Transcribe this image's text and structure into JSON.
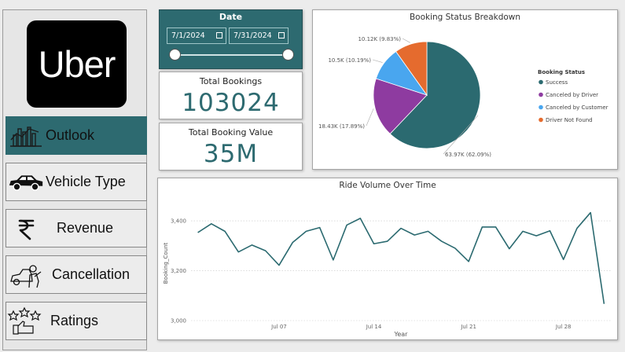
{
  "logo": {
    "text": "Uber"
  },
  "nav": [
    {
      "label": "Outlook",
      "icon": "bar-chart-icon",
      "active": true
    },
    {
      "label": "Vehicle Type",
      "icon": "car-icon",
      "active": false
    },
    {
      "label": "Revenue",
      "icon": "rupee-icon",
      "active": false
    },
    {
      "label": "Cancellation",
      "icon": "mechanic-icon",
      "active": false
    },
    {
      "label": "Ratings",
      "icon": "stars-thumbs-up-icon",
      "active": false
    }
  ],
  "date_filter": {
    "title": "Date",
    "start": "7/1/2024",
    "end": "7/31/2024"
  },
  "kpis": {
    "total_bookings": {
      "title": "Total Bookings",
      "value": "103024"
    },
    "total_booking_value": {
      "title": "Total Booking Value",
      "value": "35M"
    }
  },
  "colors": {
    "accent": "#2d6a70",
    "success": "#2b6a70",
    "driver": "#8e3ba0",
    "customer": "#49a6ef",
    "notfound": "#e56b2e"
  },
  "chart_data": [
    {
      "type": "pie",
      "title": "Booking Status Breakdown",
      "legend_title": "Booking Status",
      "legend_position": "right",
      "slices": [
        {
          "name": "Success",
          "value": 63970,
          "label": "63.97K (62.09%)",
          "color": "#2b6a70"
        },
        {
          "name": "Canceled by Driver",
          "value": 18430,
          "label": "18.43K (17.89%)",
          "color": "#8e3ba0"
        },
        {
          "name": "Canceled by Customer",
          "value": 10500,
          "label": "10.5K (10.19%)",
          "color": "#49a6ef"
        },
        {
          "name": "Driver Not Found",
          "value": 10120,
          "label": "10.12K (9.83%)",
          "color": "#e56b2e"
        }
      ]
    },
    {
      "type": "line",
      "title": "Ride Volume Over Time",
      "xlabel": "Year",
      "ylabel": "Booking_Count",
      "ylim": [
        3000,
        3460
      ],
      "yticks": [
        3000,
        3200,
        3400
      ],
      "ytick_labels": [
        "3,000",
        "3,200",
        "3,400"
      ],
      "xtick_labels": [
        "Jul 07",
        "Jul 14",
        "Jul 21",
        "Jul 28"
      ],
      "xtick_days": [
        7,
        14,
        21,
        28
      ],
      "grid": true,
      "x": [
        1,
        2,
        3,
        4,
        5,
        6,
        7,
        8,
        9,
        10,
        11,
        12,
        13,
        14,
        15,
        16,
        17,
        18,
        19,
        20,
        21,
        22,
        23,
        24,
        25,
        26,
        27,
        28,
        29,
        30,
        31
      ],
      "values": [
        3353,
        3388,
        3358,
        3275,
        3303,
        3280,
        3222,
        3313,
        3358,
        3373,
        3243,
        3383,
        3410,
        3308,
        3318,
        3370,
        3343,
        3358,
        3318,
        3290,
        3237,
        3375,
        3375,
        3288,
        3358,
        3340,
        3360,
        3245,
        3370,
        3433,
        3067
      ]
    }
  ]
}
